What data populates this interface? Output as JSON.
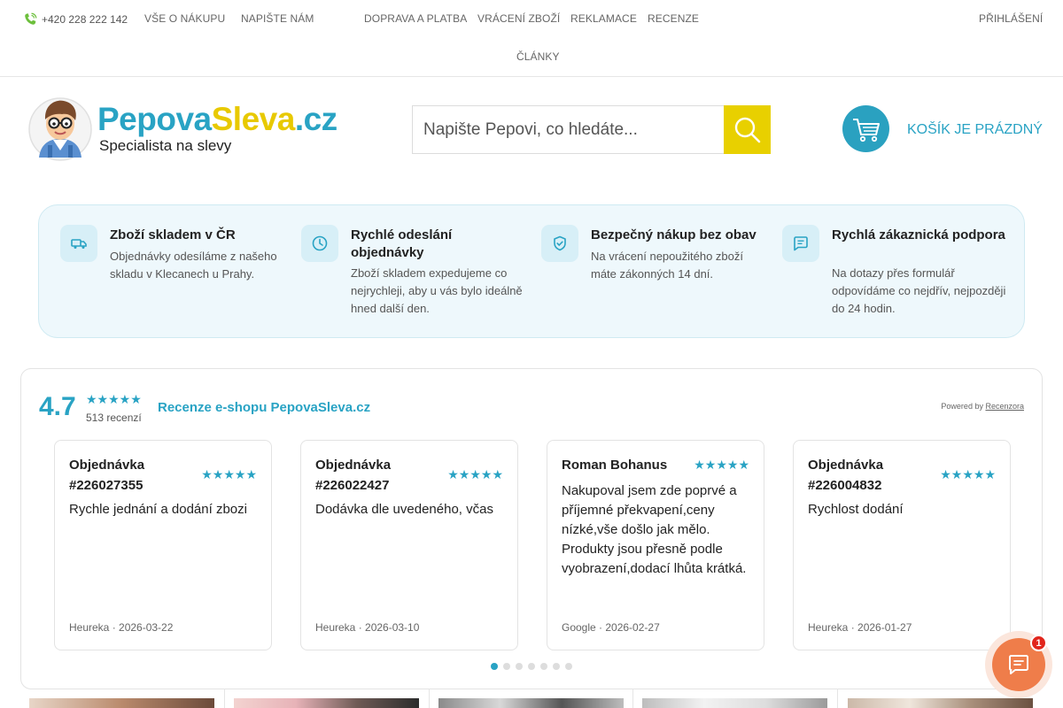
{
  "topbar": {
    "phone": "+420 228 222 142",
    "links": [
      "VŠE O NÁKUPU",
      "NAPIŠTE NÁM",
      "DOPRAVA A PLATBA",
      "VRÁCENÍ ZBOŽÍ",
      "REKLAMACE",
      "RECENZE",
      "ČLÁNKY"
    ],
    "login": "PŘIHLÁŠENÍ"
  },
  "logo": {
    "name_part1": "Pepova",
    "name_part2": "Sleva",
    "name_part3": ".cz",
    "tagline": "Specialista na slevy"
  },
  "search": {
    "placeholder": "Napište Pepovi, co hledáte..."
  },
  "cart": {
    "label": "KOŠÍK JE PRÁZDNÝ"
  },
  "benefits": [
    {
      "icon": "truck-icon",
      "title": "Zboží skladem v ČR",
      "text": "Objednávky odesíláme z našeho skladu v Klecanech u Prahy."
    },
    {
      "icon": "clock-icon",
      "title": "Rychlé odeslání objednávky",
      "text": "Zboží skladem expedujeme co nejrychleji, aby u vás bylo ideálně hned další den."
    },
    {
      "icon": "shield-check-icon",
      "title": "Bezpečný nákup bez obav",
      "text": "Na vrácení nepoužitého zboží máte zákonných 14 dní."
    },
    {
      "icon": "chat-icon",
      "title": "Rychlá zákaznická podpora",
      "text": "Na dotazy přes formulář odpovídáme co nejdřív, nejpozději do 24 hodin."
    }
  ],
  "reviews": {
    "score": "4.7",
    "stars": "★★★★★",
    "count": "513 recenzí",
    "title": "Recenze e-shopu PepovaSleva.cz",
    "powered_prefix": "Powered by",
    "powered_brand": "Recenzora",
    "cards": [
      {
        "author": "Objednávka #226027355",
        "stars": "★★★★★",
        "text": "Rychle jednání a dodání zbozi",
        "meta": "Heureka · 2026-03-22"
      },
      {
        "author": "Objednávka #226022427",
        "stars": "★★★★★",
        "text": "Dodávka dle uvedeného, včas",
        "meta": "Heureka · 2026-03-10"
      },
      {
        "author": "Roman Bohanus",
        "stars": "★★★★★",
        "text": "Nakupoval jsem zde poprvé a příjemné překvapení,ceny nízké,vše došlo jak mělo. Produkty jsou přesně podle vyobrazení,dodací lhůta krátká.",
        "meta": "Google · 2026-02-27"
      },
      {
        "author": "Objednávka #226004832",
        "stars": "★★★★★",
        "text": "Rychlost dodání",
        "meta": "Heureka · 2026-01-27"
      }
    ],
    "pagination_pages": 7,
    "active_page": 1
  },
  "chat": {
    "badge": "1"
  },
  "colors": {
    "brand_blue": "#29a3c4",
    "brand_yellow": "#e8d000",
    "chat_orange": "#ef7d4a"
  }
}
